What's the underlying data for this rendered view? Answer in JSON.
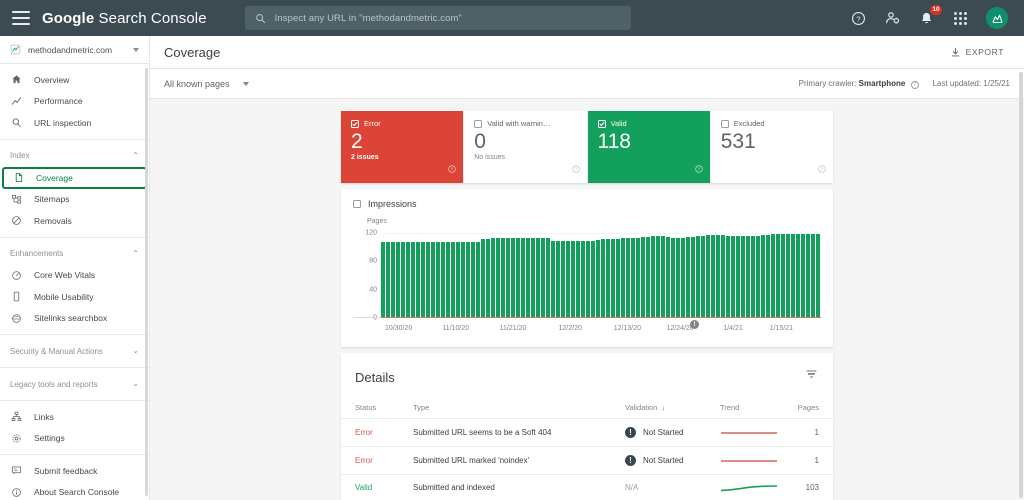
{
  "topbar": {
    "menu_icon": "hamburger-menu-icon",
    "brand_bold": "Google",
    "brand_rest": " Search Console",
    "search_placeholder": "Inspect any URL in \"methodandmetric.com\"",
    "search_value": "",
    "search_icon": "search-icon",
    "help_icon": "help-circle-icon",
    "account_icon": "account-settings-icon",
    "notifications_icon": "bell-icon",
    "notifications_badge": "10",
    "apps_icon": "apps-grid-icon",
    "avatar_icon": "user-avatar"
  },
  "sidebar": {
    "property": "methodandmetric.com",
    "property_icon": "search-console-logo-icon",
    "property_caret": "chevron-down-icon",
    "items": [
      {
        "label": "Overview",
        "icon": "home-icon",
        "active": false
      },
      {
        "label": "Performance",
        "icon": "trend-line-icon",
        "active": false
      },
      {
        "label": "URL inspection",
        "icon": "magnifier-icon",
        "active": false
      }
    ],
    "index_group": {
      "label": "Index",
      "chevron": "chevron-up-icon"
    },
    "index_items": [
      {
        "label": "Coverage",
        "icon": "document-icon",
        "active": true
      },
      {
        "label": "Sitemaps",
        "icon": "sitemap-icon",
        "active": false
      },
      {
        "label": "Removals",
        "icon": "removals-icon",
        "active": false
      }
    ],
    "enhancements_group": {
      "label": "Enhancements",
      "chevron": "chevron-up-icon"
    },
    "enhancement_items": [
      {
        "label": "Core Web Vitals",
        "icon": "speedometer-icon",
        "active": false
      },
      {
        "label": "Mobile Usability",
        "icon": "mobile-icon",
        "active": false
      },
      {
        "label": "Sitelinks searchbox",
        "icon": "sitelinks-icon",
        "active": false
      }
    ],
    "collapsed_groups": [
      {
        "label": "Security & Manual Actions",
        "chevron": "chevron-down-icon"
      },
      {
        "label": "Legacy tools and reports",
        "chevron": "chevron-down-icon"
      }
    ],
    "footer_items": [
      {
        "label": "Links",
        "icon": "links-icon"
      },
      {
        "label": "Settings",
        "icon": "gear-icon"
      }
    ],
    "footer_items2": [
      {
        "label": "Submit feedback",
        "icon": "feedback-icon"
      },
      {
        "label": "About Search Console",
        "icon": "info-icon"
      }
    ]
  },
  "page": {
    "title": "Coverage",
    "export_label": "EXPORT",
    "export_icon": "download-icon",
    "page_filter": "All known pages",
    "page_filter_caret": "chevron-down-icon",
    "crawler_label": "Primary crawler:",
    "crawler_value": "Smartphone",
    "crawler_help": "help-circle-icon",
    "last_updated_label": "Last updated:",
    "last_updated_value": "1/25/21"
  },
  "status_cards": [
    {
      "label": "Error",
      "value": "2",
      "sub": "2 issues",
      "checked": true,
      "style": "err"
    },
    {
      "label": "Valid with warnin…",
      "value": "0",
      "sub": "No issues",
      "checked": false,
      "style": "plain"
    },
    {
      "label": "Valid",
      "value": "118",
      "sub": "",
      "checked": true,
      "style": "ok"
    },
    {
      "label": "Excluded",
      "value": "531",
      "sub": "",
      "checked": false,
      "style": "plain"
    }
  ],
  "chart_panel": {
    "impressions_label": "Impressions",
    "impressions_checked": false,
    "annotation_marker": "!"
  },
  "chart_data": {
    "type": "bar",
    "title": "",
    "xlabel": "",
    "ylabel": "Pages",
    "ylim": [
      0,
      130
    ],
    "yticks": [
      0,
      40,
      80,
      120
    ],
    "grid": true,
    "legend": [
      "Valid"
    ],
    "series_color": "#12a05c",
    "baseline_color": "#c5554a",
    "categories": [
      "10/30/20",
      "10/31/20",
      "11/1/20",
      "11/2/20",
      "11/3/20",
      "11/4/20",
      "11/5/20",
      "11/6/20",
      "11/7/20",
      "11/8/20",
      "11/9/20",
      "11/10/20",
      "11/11/20",
      "11/12/20",
      "11/13/20",
      "11/14/20",
      "11/15/20",
      "11/16/20",
      "11/17/20",
      "11/18/20",
      "11/19/20",
      "11/20/20",
      "11/21/20",
      "11/22/20",
      "11/23/20",
      "11/24/20",
      "11/25/20",
      "11/26/20",
      "11/27/20",
      "11/28/20",
      "11/29/20",
      "11/30/20",
      "12/1/20",
      "12/2/20",
      "12/3/20",
      "12/4/20",
      "12/5/20",
      "12/6/20",
      "12/7/20",
      "12/8/20",
      "12/9/20",
      "12/10/20",
      "12/11/20",
      "12/12/20",
      "12/13/20",
      "12/14/20",
      "12/15/20",
      "12/16/20",
      "12/17/20",
      "12/18/20",
      "12/19/20",
      "12/20/20",
      "12/21/20",
      "12/22/20",
      "12/23/20",
      "12/24/20",
      "12/25/20",
      "12/26/20",
      "12/27/20",
      "12/28/20",
      "12/29/20",
      "12/30/20",
      "12/31/20",
      "1/1/21",
      "1/2/21",
      "1/3/21",
      "1/4/21",
      "1/5/21",
      "1/6/21",
      "1/7/21",
      "1/8/21",
      "1/9/21",
      "1/10/21",
      "1/11/21",
      "1/12/21",
      "1/13/21",
      "1/14/21",
      "1/15/21",
      "1/16/21",
      "1/17/21",
      "1/18/21",
      "1/19/21",
      "1/20/21",
      "1/21/21",
      "1/22/21",
      "1/23/21",
      "1/24/21",
      "1/25/21"
    ],
    "series": [
      {
        "name": "Valid",
        "values": [
          106,
          106,
          106,
          106,
          106,
          106,
          106,
          106,
          106,
          106,
          106,
          106,
          106,
          106,
          106,
          106,
          106,
          106,
          106,
          106,
          110,
          110,
          111,
          111,
          111,
          112,
          112,
          112,
          112,
          112,
          112,
          112,
          112,
          111,
          108,
          107,
          107,
          107,
          107,
          107,
          107,
          107,
          108,
          109,
          110,
          110,
          110,
          110,
          111,
          111,
          112,
          112,
          113,
          113,
          114,
          114,
          114,
          113,
          112,
          112,
          112,
          113,
          113,
          114,
          115,
          116,
          116,
          116,
          116,
          115,
          114,
          114,
          114,
          114,
          115,
          115,
          116,
          116,
          117,
          117,
          117,
          117,
          117,
          117,
          118,
          118,
          118,
          118
        ]
      }
    ],
    "xtick_labels": [
      "10/30/20",
      "11/10/20",
      "11/21/20",
      "12/2/20",
      "12/13/20",
      "12/24/20",
      "1/4/21",
      "1/15/21"
    ],
    "xtick_positions_pct": [
      4,
      17,
      30,
      43,
      56,
      68,
      80,
      91
    ]
  },
  "details": {
    "title": "Details",
    "filter_icon": "funnel-filter-icon",
    "columns": [
      "Status",
      "Type",
      "Validation",
      "Trend",
      "Pages"
    ],
    "sort_column": "Validation",
    "sort_icon": "arrow-down-icon",
    "rows": [
      {
        "status": "Error",
        "status_style": "error",
        "type": "Submitted URL seems to be a Soft 404",
        "validation": "Not Started",
        "validation_icon": "exclamation-circle-icon",
        "trend": "flat-red",
        "pages": "1"
      },
      {
        "status": "Error",
        "status_style": "error",
        "type": "Submitted URL marked 'noindex'",
        "validation": "Not Started",
        "validation_icon": "exclamation-circle-icon",
        "trend": "flat-red",
        "pages": "1"
      },
      {
        "status": "Valid",
        "status_style": "valid",
        "type": "Submitted and indexed",
        "validation": "N/A",
        "validation_icon": "",
        "trend": "rising-green",
        "pages": "103"
      }
    ]
  }
}
